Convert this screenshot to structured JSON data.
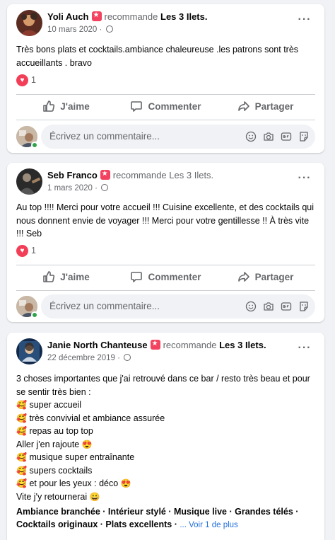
{
  "posts": [
    {
      "author": "Yoli Auch",
      "recommends": "recommande",
      "page": "Les 3 Ilets.",
      "date": "10 mars 2020 ·",
      "text": "Très bons plats et cocktails.ambiance chaleureuse .les patrons sont très accueillants . bravo",
      "reaction_count": "1",
      "avatar_colors": [
        "#8a3b2e",
        "#d9a06b",
        "#3a2a22"
      ]
    },
    {
      "author": "Seb Franco",
      "recommends": "recommande",
      "page": "Les 3 Ilets.",
      "date": "1 mars 2020 ·",
      "text": "Au top !!!! Merci pour votre accueil !!! Cuisine excellente, et des cocktails qui nous donnent envie de voyager !!! Merci pour votre gentillesse !! À très vite !!! Seb",
      "reaction_count": "1",
      "avatar_colors": [
        "#3d3d3d",
        "#8c8c8c",
        "#1f1f1f"
      ]
    },
    {
      "author": "Janie North Chanteuse",
      "recommends": "recommande",
      "page": "Les 3 Ilets.",
      "date": "22 décembre 2019 ·",
      "intro": "3 choses importantes que j'ai retrouvé dans ce bar / resto très beau et pour se sentir très bien :",
      "lines": [
        {
          "emoji": "🥰",
          "text": "super accueil"
        },
        {
          "emoji": "🥰",
          "text": "très convivial et ambiance assurée"
        },
        {
          "emoji": "🥰",
          "text": "repas au top top"
        },
        {
          "emoji": "",
          "text": "Aller j'en rajoute",
          "trail": "😍"
        },
        {
          "emoji": "🥰",
          "text": "musique super entraînante"
        },
        {
          "emoji": "🥰",
          "text": "supers cocktails"
        },
        {
          "emoji": "🥰",
          "text": "et pour les yeux : déco",
          "trail": "😍"
        },
        {
          "emoji": "",
          "text": "Vite j'y retournerai",
          "trail": "😀"
        }
      ],
      "tags_line1": "Ambiance branchée · Intérieur stylé · Musique live · Grandes télés ·",
      "tags_line2": "Cocktails originaux · Plats excellents ·",
      "see_more": "... Voir 1 de plus",
      "avatar_colors": [
        "#2a4e7a",
        "#c9d6e6",
        "#13294a"
      ]
    }
  ],
  "actions": {
    "like": "J'aime",
    "comment": "Commenter",
    "share": "Partager"
  },
  "comment_placeholder": "Écrivez un commentaire...",
  "icons": {
    "more": "more-options-icon",
    "globe": "globe-icon",
    "recommend": "recommend-star-icon",
    "heart": "heart-reaction-icon",
    "like": "thumbs-up-icon",
    "comment": "comment-bubble-icon",
    "share": "share-arrow-icon",
    "emoji": "emoji-icon",
    "camera": "camera-icon",
    "gif": "gif-icon",
    "sticker": "sticker-icon"
  },
  "colors": {
    "recommend": "#f3425f",
    "heart": "#f33e58",
    "online": "#31a24c",
    "link": "#216fdb",
    "secondary": "#65676b"
  }
}
